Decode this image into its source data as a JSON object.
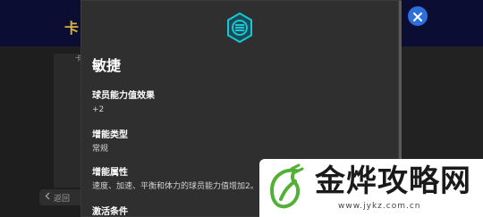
{
  "background": {
    "title": "卡",
    "small_text": "卡",
    "back_label": "返回"
  },
  "modal": {
    "skill_name": "敏捷",
    "sections": [
      {
        "label": "球员能力值效果",
        "value": "+2"
      },
      {
        "label": "增能类型",
        "value": "常规"
      },
      {
        "label": "增能属性",
        "value": "速度、加速、平衡和体力的球员能力值增加2。"
      },
      {
        "label": "激活条件",
        "value": ""
      }
    ],
    "emblem_icon": "chemistry-style-hexagon-icon"
  },
  "close_icon": "close-icon",
  "watermark": {
    "title": "金烨攻略网",
    "url": "www.jykz.com.cn"
  },
  "colors": {
    "modal_bg": "#2f2f2f",
    "accent_cyan": "#19c6d4",
    "close_blue": "#2d6fdc",
    "watermark_green": "#52b035"
  }
}
